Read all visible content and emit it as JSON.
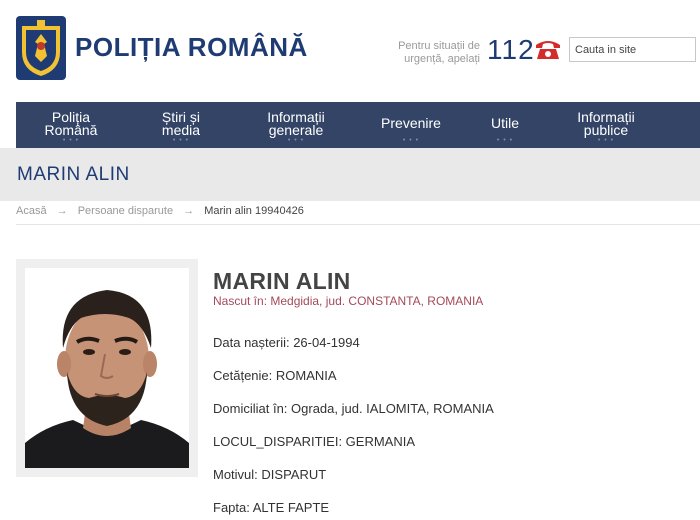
{
  "header": {
    "site_title": "POLIȚIA ROMÂNĂ",
    "emergency_text": "Pentru situații de urgență, apelați",
    "emergency_number": "112",
    "search_placeholder": "Cauta in site"
  },
  "nav": {
    "items": [
      {
        "label": "Poliția\nRomână"
      },
      {
        "label": "Știri și\nmedia"
      },
      {
        "label": "Informații\ngenerale"
      },
      {
        "label": "Prevenire"
      },
      {
        "label": "Utile"
      },
      {
        "label": "Informații\npublice"
      }
    ]
  },
  "page": {
    "title": "MARIN ALIN"
  },
  "breadcrumb": {
    "home": "Acasă",
    "section": "Persoane disparute",
    "current": "Marin alin 19940426",
    "separator": "→"
  },
  "person": {
    "name": "MARIN ALIN",
    "birthplace": "Nascut în: Medgidia, jud. CONSTANTA, ROMANIA",
    "details": [
      "Data nașterii: 26-04-1994",
      "Cetățenie: ROMANIA",
      "Domiciliat în: Ograda, jud. IALOMITA, ROMANIA",
      "LOCUL_DISPARITIEI: GERMANIA",
      "Motivul: DISPARUT",
      "Fapta: ALTE FAPTE"
    ]
  },
  "colors": {
    "brand": "#1f3b73",
    "nav_bg": "#334466",
    "birthplace": "#a34a5a",
    "phone_icon": "#d42b2b"
  }
}
